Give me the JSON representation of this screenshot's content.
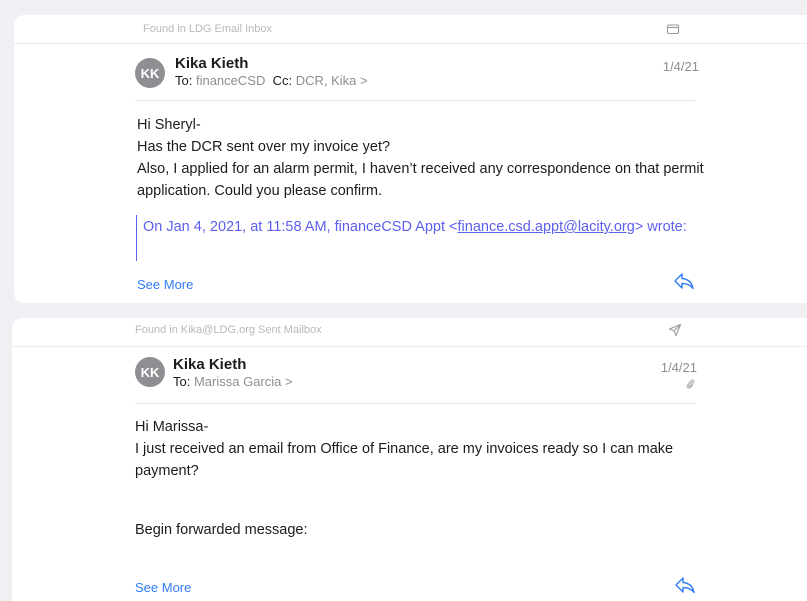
{
  "colors": {
    "accent": "#2f7cf6",
    "quote": "#5d5fef",
    "avatar": "#8e8e93",
    "background": "#efeff4"
  },
  "messages": [
    {
      "found_in": "Found in LDG Email Inbox",
      "found_icon": "tray-icon",
      "avatar_initials": "KK",
      "sender": "Kika Kieth",
      "to_label": "To:",
      "to_value": "financeCSD",
      "cc_label": "Cc:",
      "cc_value": "DCR, Kika >",
      "date": "1/4/21",
      "body": [
        "Hi Sheryl-",
        "Has the DCR sent over my invoice yet?",
        "Also, I applied for an alarm permit, I haven’t received any correspondence on that permit application. Could you please confirm."
      ],
      "quote_prefix": "On Jan 4, 2021, at 11:58 AM, financeCSD Appt <",
      "quote_email": "finance.csd.appt@lacity.org",
      "quote_suffix": "> wrote:",
      "see_more": "See More"
    },
    {
      "found_in": "Found in Kika@LDG.org Sent Mailbox",
      "found_icon": "sent-icon",
      "avatar_initials": "KK",
      "sender": "Kika Kieth",
      "to_label": "To:",
      "to_value": "Marissa Garcia >",
      "date": "1/4/21",
      "has_attachment": true,
      "body": [
        "Hi Marissa-",
        "I just received an email from Office of Finance, are my invoices ready so I can make payment?"
      ],
      "forwarded": "Begin forwarded message:",
      "see_more": "See More"
    }
  ]
}
